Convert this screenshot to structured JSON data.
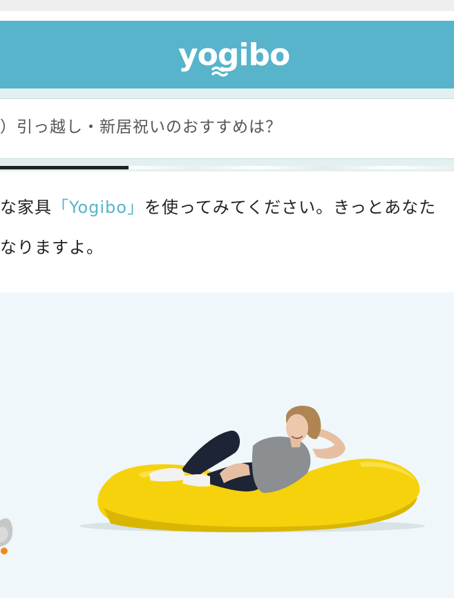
{
  "header": {
    "logo_text": "yogibo",
    "brand_color": "#57b4cb"
  },
  "article": {
    "title": "）引っ越し・新居祝いのおすすめは？",
    "paragraph": {
      "line1_before": "な家具",
      "line1_link": "「Yogibo」",
      "line1_after": "を使ってみてください。きっとあなた",
      "line2": "なりますよ。"
    },
    "link_color": "#57b4cb"
  },
  "image": {
    "subject": "woman reclining on yellow beanbag sofa",
    "sofa_color": "#f6d20c",
    "background_color": "#eff7fa"
  }
}
